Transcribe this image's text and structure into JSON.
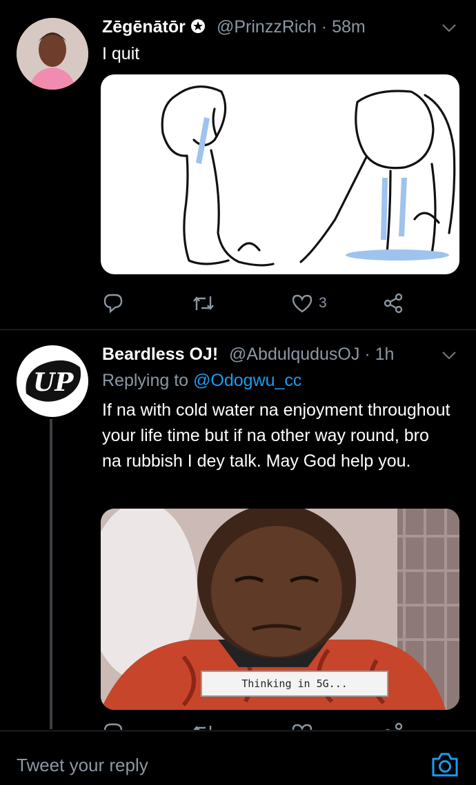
{
  "tweet1": {
    "name": "Zēgēnātōr",
    "handle": "@PrinzzRich · 58m",
    "text": "I quit",
    "like_count": "3"
  },
  "tweet2": {
    "name": "Beardless OJ!",
    "handle": "@AbdulqudusOJ · 1h",
    "replying_prefix": "Replying to",
    "replying_handle": "@Odogwu_cc",
    "text": "If na with cold water na enjoyment throughout your life time but if na other way round, bro na rubbish I dey talk. May God help you.",
    "avatar_logo": "UP",
    "image_caption": "Thinking in 5G..."
  },
  "reply": {
    "placeholder": "Tweet your reply"
  },
  "colors": {
    "background": "#000000",
    "secondary_text": "#8b98a5",
    "link": "#1d9bf0",
    "divider": "#2f3336"
  },
  "icons": [
    "verified-badge-icon",
    "chevron-down-icon",
    "reply-icon",
    "retweet-icon",
    "like-icon",
    "share-icon",
    "camera-icon"
  ]
}
